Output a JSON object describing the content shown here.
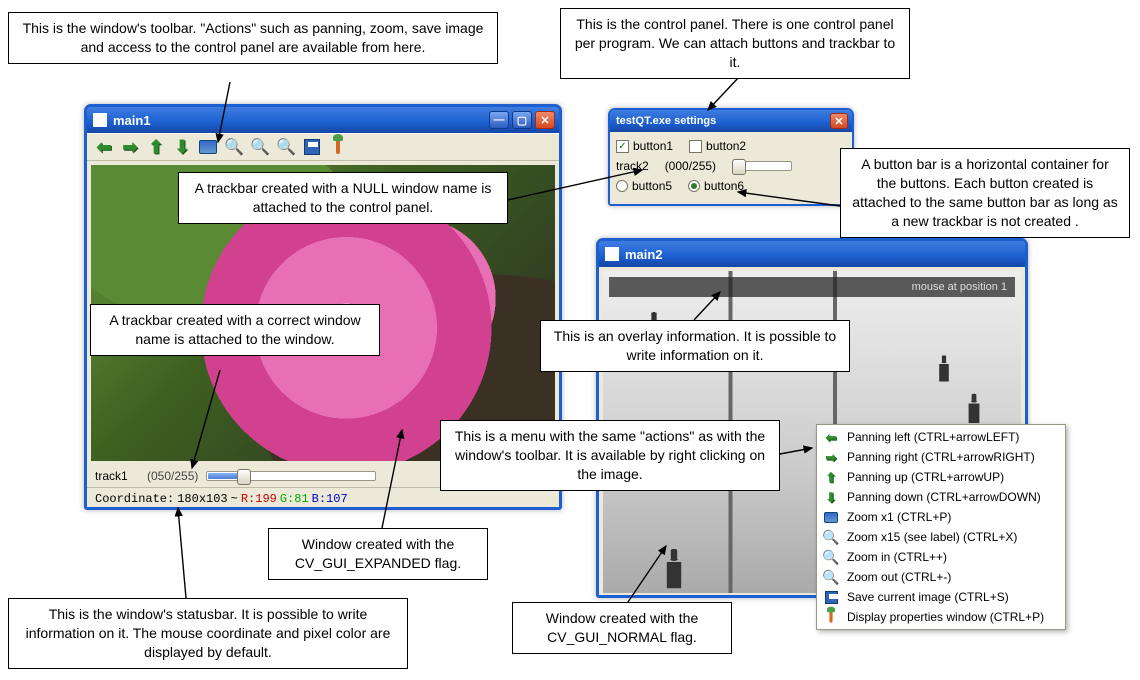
{
  "callouts": {
    "toolbar": "This is the window's toolbar. \"Actions\" such as panning, zoom, save image and access to the control panel are available from here.",
    "controlpanel": "This is the control panel. There is one control panel per program. We can attach buttons and trackbar to it.",
    "trackbar_null": "A trackbar created with a NULL window name is attached to the control panel.",
    "buttonbar": "A button bar is a horizontal container for the buttons. Each button created is attached to the same button bar as long as a new trackbar is not created .",
    "trackbar_named": "A trackbar created with a correct window name is attached to the window.",
    "overlay": "This is an overlay information. It is possible to write information on it.",
    "menu": "This is a menu with the same \"actions\" as with the window's toolbar. It is available by right clicking on the image.",
    "expanded": "Window created with the CV_GUI_EXPANDED flag.",
    "normal": "Window created with the CV_GUI_NORMAL flag.",
    "statusbar": "This is the window's statusbar. It is possible to write information on it. The mouse coordinate and pixel color are displayed by default."
  },
  "main1": {
    "title": "main1",
    "trackbar": {
      "name": "track1",
      "value_text": "(050/255)",
      "value": 50,
      "max": 255
    },
    "status": {
      "prefix": "Coordinate:",
      "coord": "180x103",
      "sep": "~",
      "r": "R:199",
      "g": "G:81",
      "b": "B:107"
    }
  },
  "controlpanel": {
    "title": "testQT.exe settings",
    "buttons": {
      "b1": "button1",
      "b2": "button2",
      "b5": "button5",
      "b6": "button6"
    },
    "trackbar": {
      "name": "track2",
      "value_text": "(000/255)"
    }
  },
  "main2": {
    "title": "main2",
    "overlay_text": "mouse at position 1"
  },
  "contextmenu": [
    {
      "icon": "arrow-left",
      "label": "Panning left (CTRL+arrowLEFT)"
    },
    {
      "icon": "arrow-right",
      "label": "Panning right (CTRL+arrowRIGHT)"
    },
    {
      "icon": "arrow-up",
      "label": "Panning up (CTRL+arrowUP)"
    },
    {
      "icon": "arrow-down",
      "label": "Panning down (CTRL+arrowDOWN)"
    },
    {
      "icon": "zoom-x1",
      "label": "Zoom x1 (CTRL+P)"
    },
    {
      "icon": "zoom-region",
      "label": "Zoom x15 (see label) (CTRL+X)"
    },
    {
      "icon": "zoom-in",
      "label": "Zoom in (CTRL++)"
    },
    {
      "icon": "zoom-out",
      "label": "Zoom out (CTRL+-)"
    },
    {
      "icon": "save",
      "label": "Save current image (CTRL+S)"
    },
    {
      "icon": "properties",
      "label": "Display properties window (CTRL+P)"
    }
  ]
}
